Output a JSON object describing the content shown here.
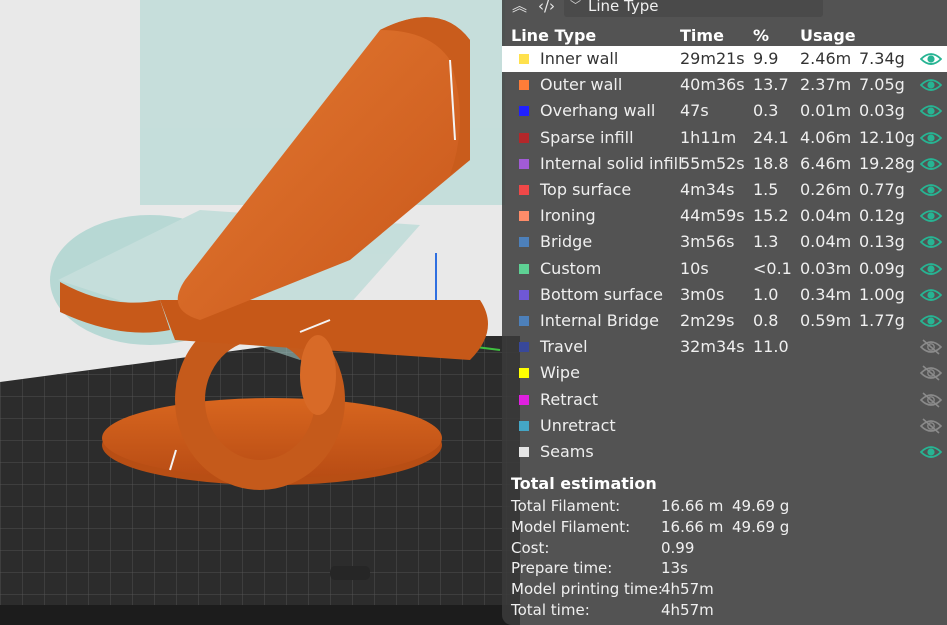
{
  "viewer": {
    "view_mode": "Line Type"
  },
  "legend": {
    "headers": {
      "line_type": "Line Type",
      "time": "Time",
      "percent": "%",
      "usage": "Usage"
    },
    "rows": [
      {
        "name": "Inner wall",
        "time": "29m21s",
        "percent": "9.9",
        "length": "2.46m",
        "weight": "7.34g",
        "color": "#ffe14d",
        "visible": true,
        "selected": true
      },
      {
        "name": "Outer wall",
        "time": "40m36s",
        "percent": "13.7",
        "length": "2.37m",
        "weight": "7.05g",
        "color": "#ff7d38",
        "visible": true
      },
      {
        "name": "Overhang wall",
        "time": "47s",
        "percent": "0.3",
        "length": "0.01m",
        "weight": "0.03g",
        "color": "#2020ff",
        "visible": true
      },
      {
        "name": "Sparse infill",
        "time": "1h11m",
        "percent": "24.1",
        "length": "4.06m",
        "weight": "12.10g",
        "color": "#b3272a",
        "visible": true
      },
      {
        "name": "Internal solid infill",
        "time": "55m52s",
        "percent": "18.8",
        "length": "6.46m",
        "weight": "19.28g",
        "color": "#a15bd6",
        "visible": true
      },
      {
        "name": "Top surface",
        "time": "4m34s",
        "percent": "1.5",
        "length": "0.26m",
        "weight": "0.77g",
        "color": "#f04848",
        "visible": true
      },
      {
        "name": "Ironing",
        "time": "44m59s",
        "percent": "15.2",
        "length": "0.04m",
        "weight": "0.12g",
        "color": "#ff8c69",
        "visible": true
      },
      {
        "name": "Bridge",
        "time": "3m56s",
        "percent": "1.3",
        "length": "0.04m",
        "weight": "0.13g",
        "color": "#4d80ba",
        "visible": true
      },
      {
        "name": "Custom",
        "time": "10s",
        "percent": "<0.1",
        "length": "0.03m",
        "weight": "0.09g",
        "color": "#5ed194",
        "visible": true
      },
      {
        "name": "Bottom surface",
        "time": "3m0s",
        "percent": "1.0",
        "length": "0.34m",
        "weight": "1.00g",
        "color": "#6f58d6",
        "visible": true
      },
      {
        "name": "Internal Bridge",
        "time": "2m29s",
        "percent": "0.8",
        "length": "0.59m",
        "weight": "1.77g",
        "color": "#4d80ba",
        "visible": true
      },
      {
        "name": "Travel",
        "time": "32m34s",
        "percent": "11.0",
        "length": "",
        "weight": "",
        "color": "#38489a",
        "visible": false
      },
      {
        "name": "Wipe",
        "time": "",
        "percent": "",
        "length": "",
        "weight": "",
        "color": "#ffff00",
        "visible": false
      },
      {
        "name": "Retract",
        "time": "",
        "percent": "",
        "length": "",
        "weight": "",
        "color": "#e020e0",
        "visible": false
      },
      {
        "name": "Unretract",
        "time": "",
        "percent": "",
        "length": "",
        "weight": "",
        "color": "#44a6c6",
        "visible": false
      },
      {
        "name": "Seams",
        "time": "",
        "percent": "",
        "length": "",
        "weight": "",
        "color": "#e6e6e6",
        "visible": true
      }
    ]
  },
  "estimation": {
    "title": "Total estimation",
    "items": [
      {
        "label": "Total Filament:",
        "value": "16.66 m",
        "value2": "49.69 g"
      },
      {
        "label": "Model Filament:",
        "value": "16.66 m",
        "value2": "49.69 g"
      },
      {
        "label": "Cost:",
        "value": "0.99",
        "value2": ""
      },
      {
        "label": "Prepare time:",
        "value": "13s",
        "value2": ""
      },
      {
        "label": "Model printing time:",
        "value": "4h57m",
        "value2": ""
      },
      {
        "label": "Total time:",
        "value": "4h57m",
        "value2": ""
      }
    ]
  },
  "colors": {
    "panel_bg": "#3a3a3a",
    "model_orange": "#d9651f",
    "eye_visible": "#27b493",
    "eye_hidden": "#8a8a8a"
  }
}
